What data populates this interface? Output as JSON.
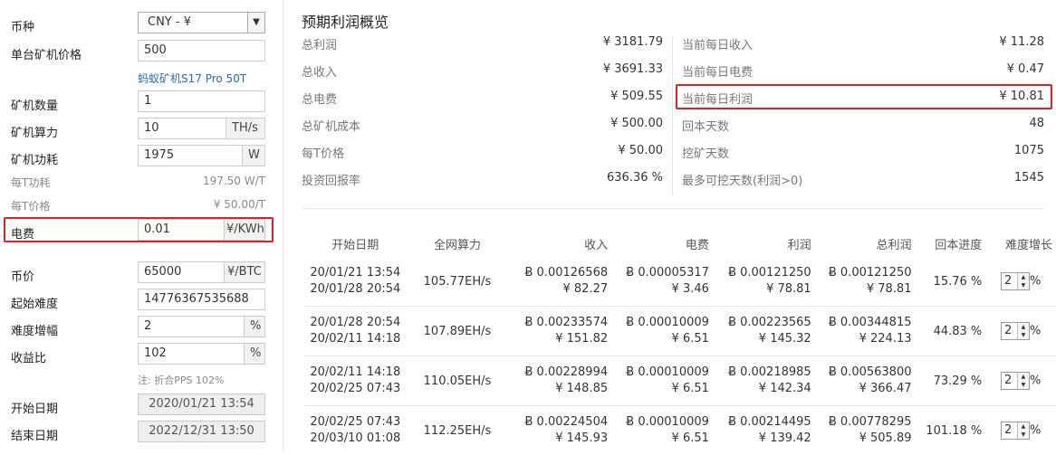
{
  "form": {
    "currency": {
      "label": "币种",
      "value": "CNY - ¥"
    },
    "price": {
      "label": "单台矿机价格",
      "value": "500"
    },
    "model_link": "蚂蚁矿机S17 Pro 50T",
    "count": {
      "label": "矿机数量",
      "value": "1"
    },
    "hashrate": {
      "label": "矿机算力",
      "value": "10",
      "unit": "TH/s"
    },
    "power": {
      "label": "矿机功耗",
      "value": "1975",
      "unit": "W"
    },
    "power_per_t": {
      "label": "每T功耗",
      "value": "197.50 W/T"
    },
    "price_per_t": {
      "label": "每T价格",
      "value": "¥ 50.00/T"
    },
    "electricity": {
      "label": "电费",
      "value": "0.01",
      "unit": "¥/KWh"
    },
    "coin_price": {
      "label": "币价",
      "value": "65000",
      "unit": "¥/BTC"
    },
    "start_difficulty": {
      "label": "起始难度",
      "value": "14776367535688"
    },
    "difficulty_growth": {
      "label": "难度增幅",
      "value": "2",
      "unit": "%"
    },
    "yield_ratio": {
      "label": "收益比",
      "value": "102",
      "unit": "%"
    },
    "yield_note": "注: 折合PPS 102%",
    "start_date": {
      "label": "开始日期",
      "value": "2020/01/21 13:54"
    },
    "end_date": {
      "label": "结束日期",
      "value": "2022/12/31 13:50"
    }
  },
  "summary": {
    "title": "预期利润概览",
    "left": [
      {
        "k": "总利润",
        "v": "¥ 3181.79"
      },
      {
        "k": "总收入",
        "v": "¥ 3691.33"
      },
      {
        "k": "总电费",
        "v": "¥ 509.55"
      },
      {
        "k": "总矿机成本",
        "v": "¥ 500.00"
      },
      {
        "k": "每T价格",
        "v": "¥ 50.00"
      },
      {
        "k": "投资回报率",
        "v": "636.36 %"
      }
    ],
    "right": [
      {
        "k": "当前每日收入",
        "v": "¥ 11.28"
      },
      {
        "k": "当前每日电费",
        "v": "¥ 0.47"
      },
      {
        "k": "当前每日利润",
        "v": "¥ 10.81"
      },
      {
        "k": "回本天数",
        "v": "48"
      },
      {
        "k": "挖矿天数",
        "v": "1075"
      },
      {
        "k": "最多可挖天数(利润>0)",
        "v": "1545"
      }
    ]
  },
  "table": {
    "headers": [
      "开始日期",
      "全网算力",
      "收入",
      "电费",
      "利润",
      "总利润",
      "回本进度",
      "难度增长"
    ],
    "rows": [
      {
        "d1": "20/01/21 13:54",
        "d2": "20/01/28 20:54",
        "hash": "105.77EH/s",
        "inc1": "Ƀ 0.00126568",
        "inc2": "¥ 82.27",
        "ele1": "Ƀ 0.00005317",
        "ele2": "¥ 3.46",
        "pro1": "Ƀ 0.00121250",
        "pro2": "¥ 78.81",
        "tot1": "Ƀ 0.00121250",
        "tot2": "¥ 78.81",
        "prog": "15.76 %",
        "growth": "2",
        "pct": "%"
      },
      {
        "d1": "20/01/28 20:54",
        "d2": "20/02/11 14:18",
        "hash": "107.89EH/s",
        "inc1": "Ƀ 0.00233574",
        "inc2": "¥ 151.82",
        "ele1": "Ƀ 0.00010009",
        "ele2": "¥ 6.51",
        "pro1": "Ƀ 0.00223565",
        "pro2": "¥ 145.32",
        "tot1": "Ƀ 0.00344815",
        "tot2": "¥ 224.13",
        "prog": "44.83 %",
        "growth": "2",
        "pct": "%"
      },
      {
        "d1": "20/02/11 14:18",
        "d2": "20/02/25 07:43",
        "hash": "110.05EH/s",
        "inc1": "Ƀ 0.00228994",
        "inc2": "¥ 148.85",
        "ele1": "Ƀ 0.00010009",
        "ele2": "¥ 6.51",
        "pro1": "Ƀ 0.00218985",
        "pro2": "¥ 142.34",
        "tot1": "Ƀ 0.00563800",
        "tot2": "¥ 366.47",
        "prog": "73.29 %",
        "growth": "2",
        "pct": "%"
      },
      {
        "d1": "20/02/25 07:43",
        "d2": "20/03/10 01:08",
        "hash": "112.25EH/s",
        "inc1": "Ƀ 0.00224504",
        "inc2": "¥ 145.93",
        "ele1": "Ƀ 0.00010009",
        "ele2": "¥ 6.51",
        "pro1": "Ƀ 0.00214495",
        "pro2": "¥ 139.42",
        "tot1": "Ƀ 0.00778295",
        "tot2": "¥ 505.89",
        "prog": "101.18 %",
        "growth": "2",
        "pct": "%"
      }
    ]
  }
}
